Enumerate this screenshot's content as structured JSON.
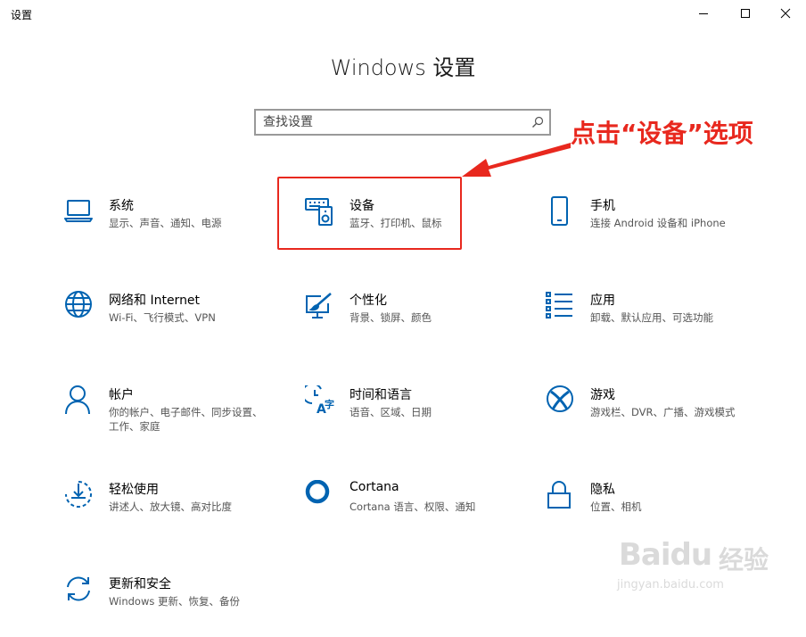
{
  "window": {
    "app_title": "设置",
    "controls": [
      "minimize-icon",
      "maximize-icon",
      "close-icon"
    ]
  },
  "header": {
    "title": "Windows 设置"
  },
  "search": {
    "placeholder": "查找设置",
    "icon": "search-icon"
  },
  "colors": {
    "accent": "#0063b1",
    "annotation_red": "#e8281e",
    "desc_gray": "#555555"
  },
  "tiles": [
    {
      "name": "系统",
      "desc": "显示、声音、通知、电源",
      "icon": "laptop-icon"
    },
    {
      "name": "设备",
      "desc": "蓝牙、打印机、鼠标",
      "icon": "keyboard-speaker-icon"
    },
    {
      "name": "手机",
      "desc": "连接 Android 设备和 iPhone",
      "icon": "phone-icon"
    },
    {
      "name": "网络和 Internet",
      "desc": "Wi-Fi、飞行模式、VPN",
      "icon": "globe-icon"
    },
    {
      "name": "个性化",
      "desc": "背景、锁屏、颜色",
      "icon": "paint-brush-icon"
    },
    {
      "name": "应用",
      "desc": "卸载、默认应用、可选功能",
      "icon": "app-list-icon"
    },
    {
      "name": "帐户",
      "desc": "你的帐户、电子邮件、同步设置、工作、家庭",
      "icon": "person-icon"
    },
    {
      "name": "时间和语言",
      "desc": "语音、区域、日期",
      "icon": "time-language-icon"
    },
    {
      "name": "游戏",
      "desc": "游戏栏、DVR、广播、游戏模式",
      "icon": "xbox-icon"
    },
    {
      "name": "轻松使用",
      "desc": "讲述人、放大镜、高对比度",
      "icon": "ease-of-access-icon"
    },
    {
      "name": "Cortana",
      "desc": "Cortana 语言、权限、通知",
      "icon": "cortana-ring-icon"
    },
    {
      "name": "隐私",
      "desc": "位置、相机",
      "icon": "lock-icon"
    },
    {
      "name": "更新和安全",
      "desc": "Windows 更新、恢复、备份",
      "icon": "sync-arrows-icon"
    }
  ],
  "annotation": {
    "text": "点击“设备”选项"
  },
  "watermark": {
    "logo": "Baidu",
    "cn": "经验",
    "url": "jingyan.baidu.com"
  }
}
